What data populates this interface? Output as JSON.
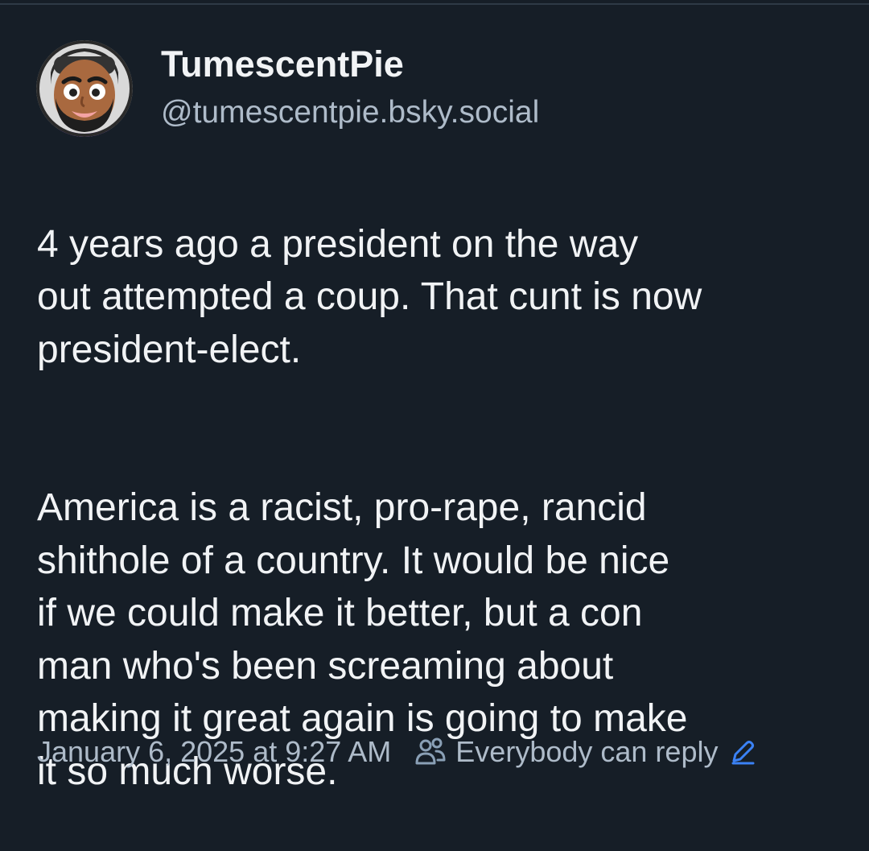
{
  "post": {
    "author": {
      "display_name": "TumescentPie",
      "handle": "@tumescentpie.bsky.social",
      "avatar_icon": "cartoon-avatar-icon"
    },
    "body": {
      "paragraph_1": "4 years ago a president on the way\nout attempted a coup. That cunt is now\npresident-elect.",
      "paragraph_2": "America is a racist, pro-rape, rancid\nshithole of a country. It would be nice\nif we could make it better, but a con\nman who's been screaming about\nmaking it great again is going to make\nit so much worse."
    },
    "meta": {
      "timestamp": "January 6, 2025 at 9:27 AM",
      "reply_setting_label": "Everybody can reply",
      "people_icon": "people-icon",
      "edit_icon": "pencil-icon"
    }
  },
  "colors": {
    "background": "#161e27",
    "text_primary": "#f1f3f5",
    "text_secondary": "#aebbc9",
    "icon_people": "#8aa0b6",
    "accent": "#3b82f6"
  }
}
